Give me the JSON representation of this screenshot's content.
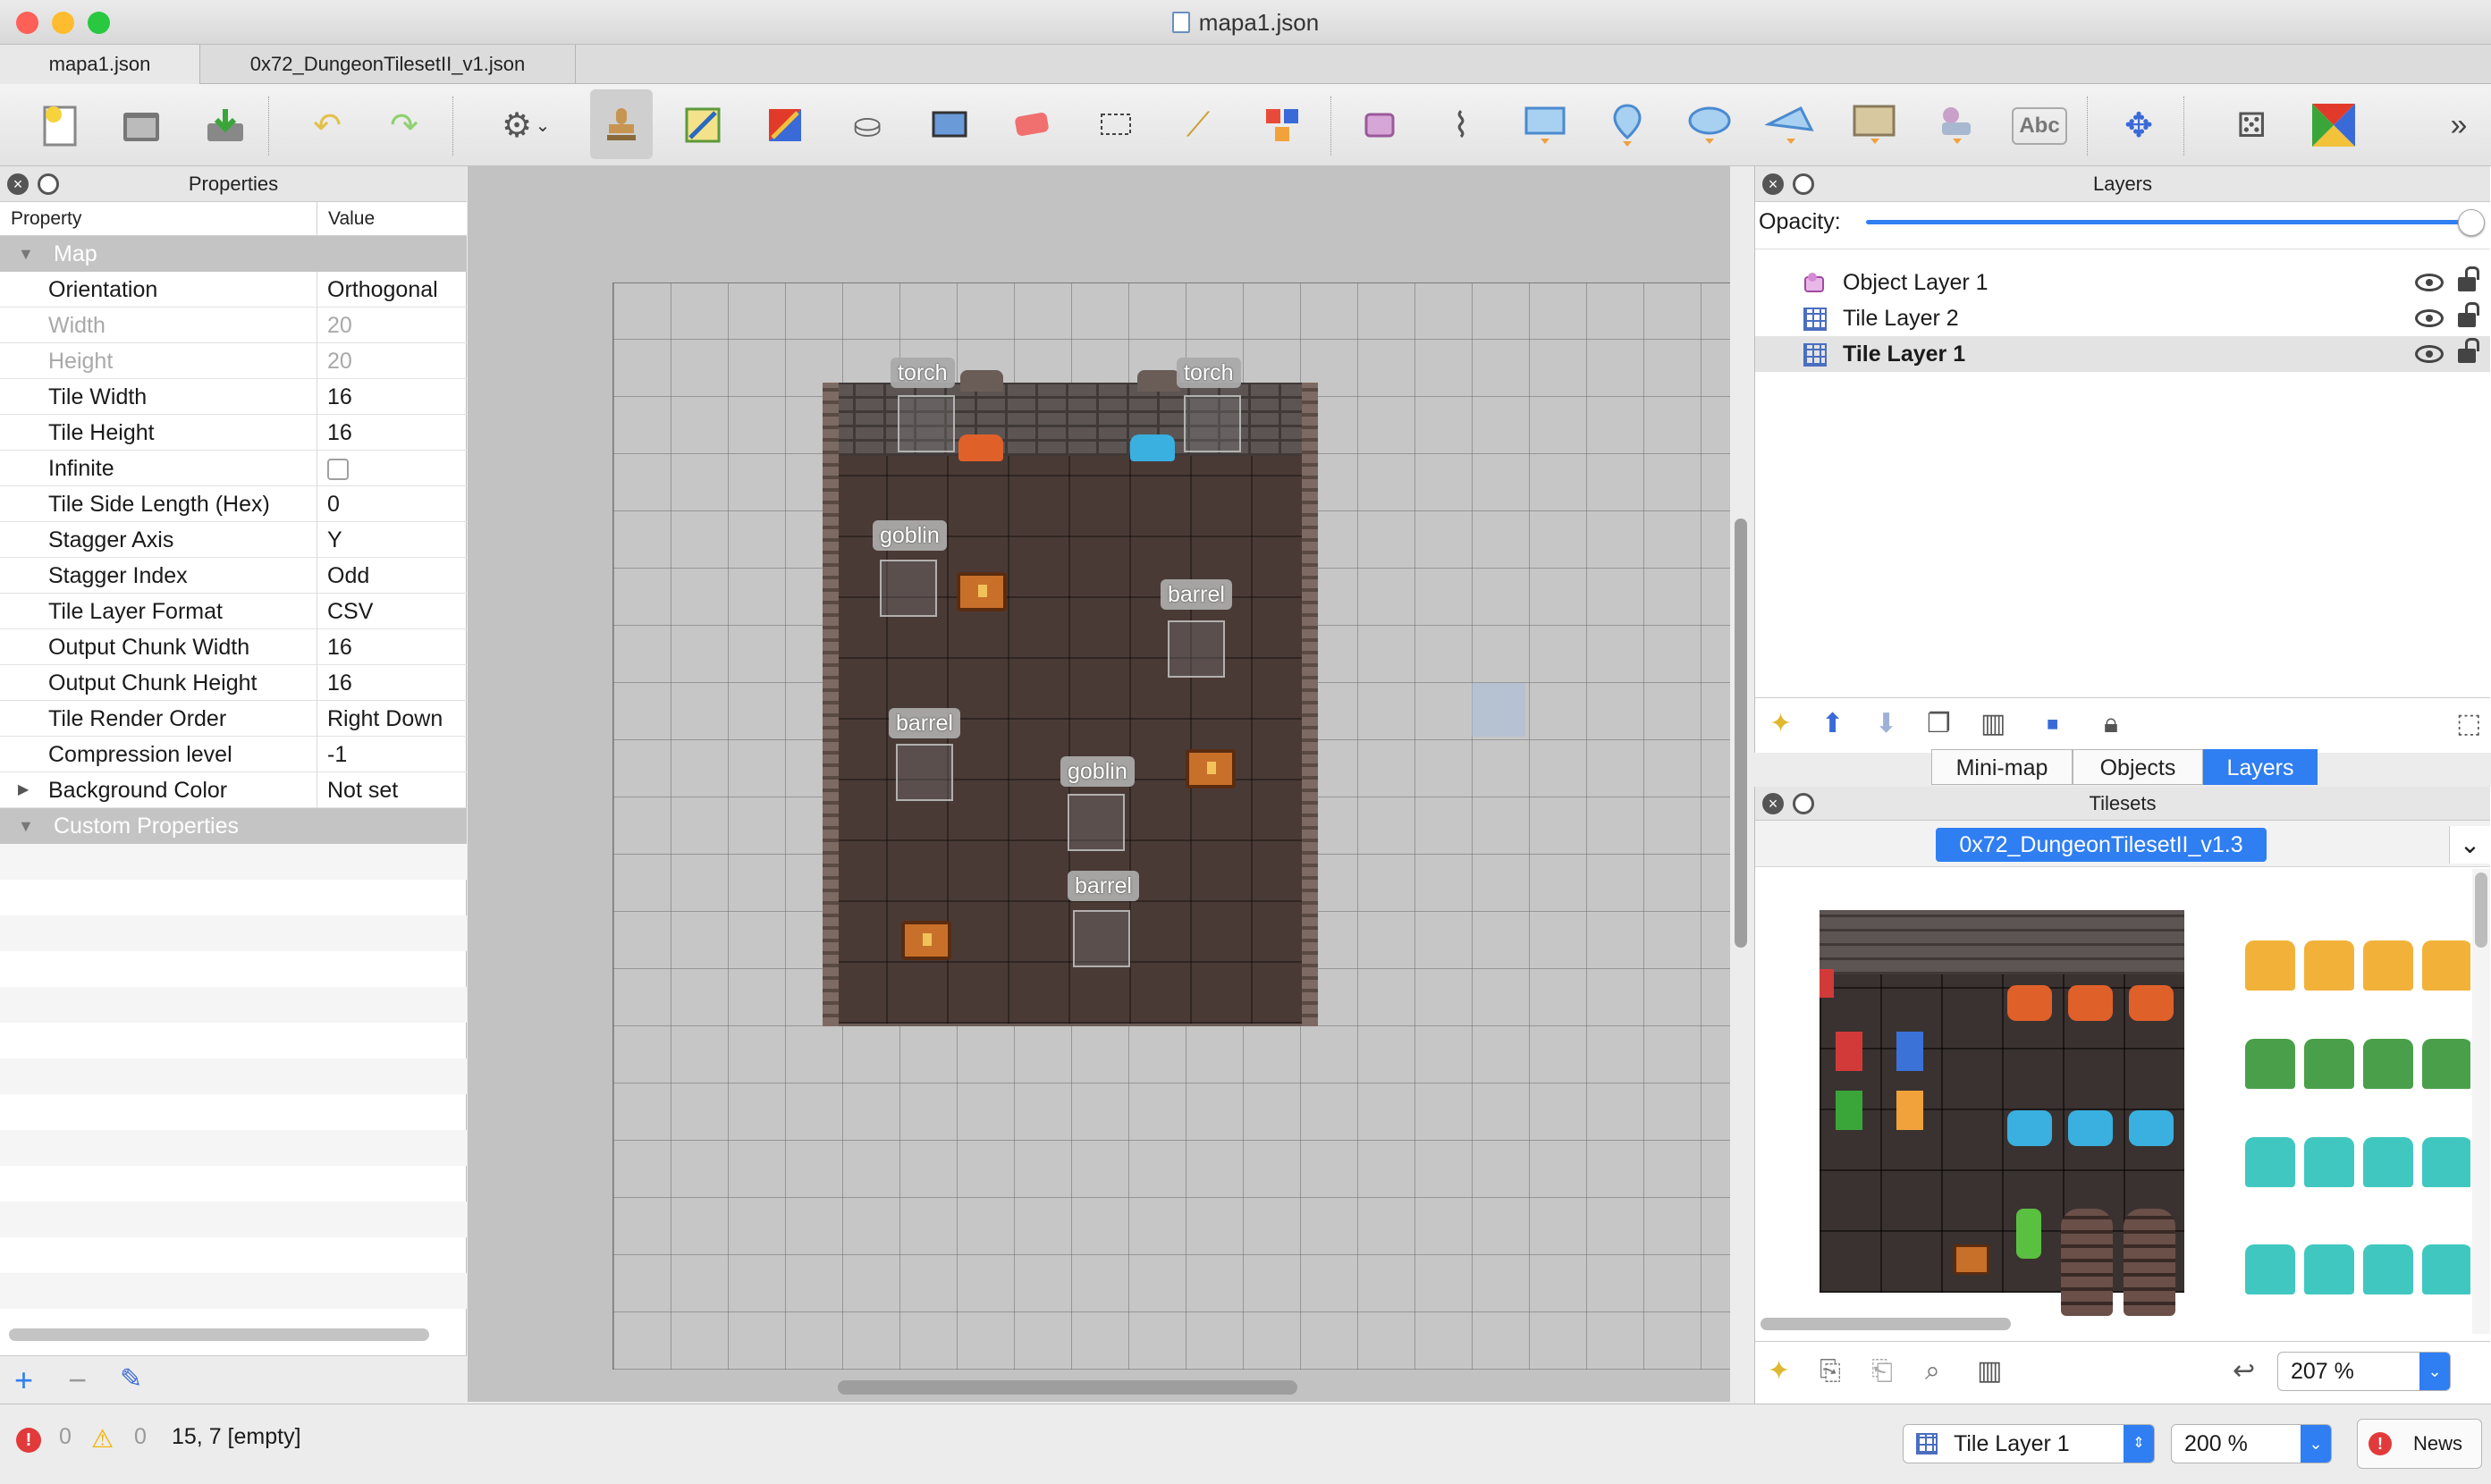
{
  "window": {
    "title": "mapa1.json"
  },
  "doc_tabs": [
    "mapa1.json",
    "0x72_DungeonTilesetII_v1.json"
  ],
  "toolbar": {
    "icons": [
      "new-map-icon",
      "open-icon",
      "save-icon",
      "undo-icon",
      "redo-icon",
      "commands-icon",
      "stamp-brush-icon",
      "terrain-brush-icon",
      "wang-brush-icon",
      "bucket-fill-icon",
      "shape-fill-icon",
      "eraser-icon",
      "rectangular-select-icon",
      "magic-wand-icon",
      "select-same-tile-icon",
      "select-objects-icon",
      "edit-polygons-icon",
      "insert-rectangle-icon",
      "insert-point-icon",
      "insert-ellipse-icon",
      "insert-polygon-icon",
      "insert-tile-icon",
      "insert-template-icon",
      "insert-text-icon",
      "move-icon",
      "random-mode-icon",
      "wang-fill-icon",
      "more-icon"
    ],
    "text_tool_label": "Abc"
  },
  "properties": {
    "title": "Properties",
    "col_property": "Property",
    "col_value": "Value",
    "group_map": "Map",
    "rows": [
      {
        "key": "Orientation",
        "value": "Orthogonal",
        "disabled": false
      },
      {
        "key": "Width",
        "value": "20",
        "disabled": true
      },
      {
        "key": "Height",
        "value": "20",
        "disabled": true
      },
      {
        "key": "Tile Width",
        "value": "16",
        "disabled": false
      },
      {
        "key": "Tile Height",
        "value": "16",
        "disabled": false
      },
      {
        "key": "Infinite",
        "value": "",
        "disabled": false
      },
      {
        "key": "Tile Side Length (Hex)",
        "value": "0",
        "disabled": false
      },
      {
        "key": "Stagger Axis",
        "value": "Y",
        "disabled": false
      },
      {
        "key": "Stagger Index",
        "value": "Odd",
        "disabled": false
      },
      {
        "key": "Tile Layer Format",
        "value": "CSV",
        "disabled": false
      },
      {
        "key": "Output Chunk Width",
        "value": "16",
        "disabled": false
      },
      {
        "key": "Output Chunk Height",
        "value": "16",
        "disabled": false
      },
      {
        "key": "Tile Render Order",
        "value": "Right Down",
        "disabled": false
      },
      {
        "key": "Compression level",
        "value": "-1",
        "disabled": false
      },
      {
        "key": "Background Color",
        "value": "Not set",
        "disabled": false
      }
    ],
    "group_custom": "Custom Properties"
  },
  "map_objects": {
    "torch_left": "torch",
    "torch_right": "torch",
    "goblin_1": "goblin",
    "barrel_1": "barrel",
    "barrel_2": "barrel",
    "goblin_2": "goblin",
    "barrel_3": "barrel"
  },
  "layers": {
    "title": "Layers",
    "opacity_label": "Opacity:",
    "opacity_value": 1.0,
    "items": [
      {
        "name": "Object Layer 1",
        "type": "object",
        "selected": false
      },
      {
        "name": "Tile Layer 2",
        "type": "tile",
        "selected": false
      },
      {
        "name": "Tile Layer 1",
        "type": "tile",
        "selected": true
      }
    ],
    "tabs": [
      "Mini-map",
      "Objects",
      "Layers"
    ],
    "active_tab": "Layers"
  },
  "tilesets": {
    "title": "Tilesets",
    "active": "0x72_DungeonTilesetII_v1.3",
    "zoom": "207 %"
  },
  "status": {
    "errors": "0",
    "warnings": "0",
    "position": "15, 7 [empty]",
    "current_layer": "Tile Layer 1",
    "zoom": "200 %",
    "news": "News"
  },
  "colors": {
    "accent": "#2f7ef2",
    "selected_row": "#e3e3e3"
  }
}
